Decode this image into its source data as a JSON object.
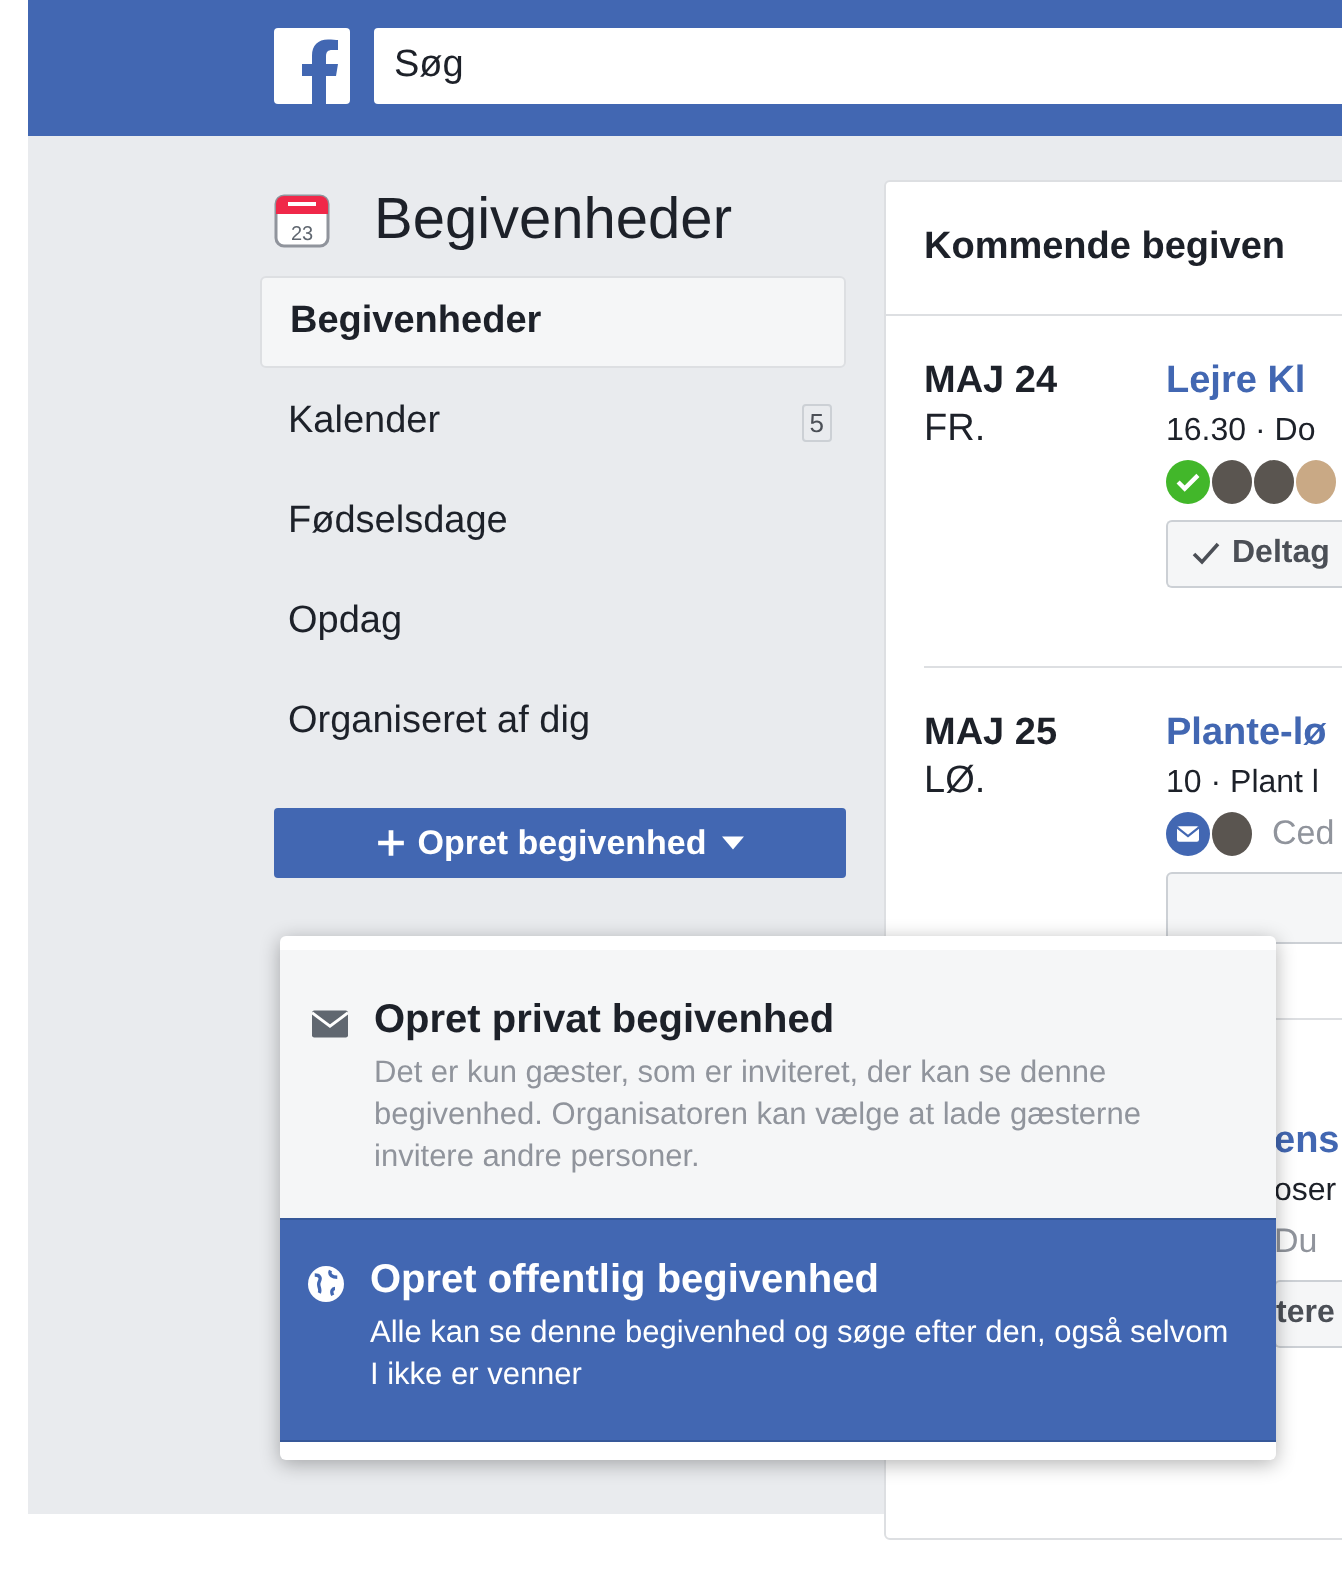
{
  "topbar": {
    "search": {
      "placeholder": "Søg"
    }
  },
  "sidebar": {
    "icon_day": "23",
    "title": "Begivenheder",
    "items": [
      {
        "label": "Begivenheder",
        "selected": true
      },
      {
        "label": "Kalender",
        "selected": false,
        "count": "5"
      },
      {
        "label": "Fødselsdage",
        "selected": false
      },
      {
        "label": "Opdag",
        "selected": false
      },
      {
        "label": "Organiseret af dig",
        "selected": false
      }
    ],
    "create_button": {
      "label": "Opret begivenhed"
    }
  },
  "dropdown": {
    "items": [
      {
        "kind": "private",
        "title": "Opret privat begivenhed",
        "description": "Det er kun gæster, som er inviteret, der kan se denne begivenhed. Organisatoren kan vælge at lade gæsterne invitere andre personer.",
        "selected": false
      },
      {
        "kind": "public",
        "title": "Opret offentlig begivenhed",
        "description": "Alle kan se denne begivenhed og søge efter den, også selvom I ikke er venner",
        "selected": true
      }
    ]
  },
  "main": {
    "title": "Kommende begiven",
    "events": [
      {
        "kind": "going",
        "month_day": "MAJ 24",
        "weekday": "FR.",
        "title": "Lejre Kl",
        "details": "16.30 · Do",
        "button": "Deltag"
      },
      {
        "kind": "invited",
        "month_day": "MAJ 25",
        "weekday": "LØ.",
        "title": "Plante-lø",
        "details": "10 · Plant l",
        "guests_text": "Ced"
      },
      {
        "kind": "covered",
        "title": "ens",
        "details": "oser",
        "guests_text": "Du",
        "button": "tere"
      }
    ]
  }
}
